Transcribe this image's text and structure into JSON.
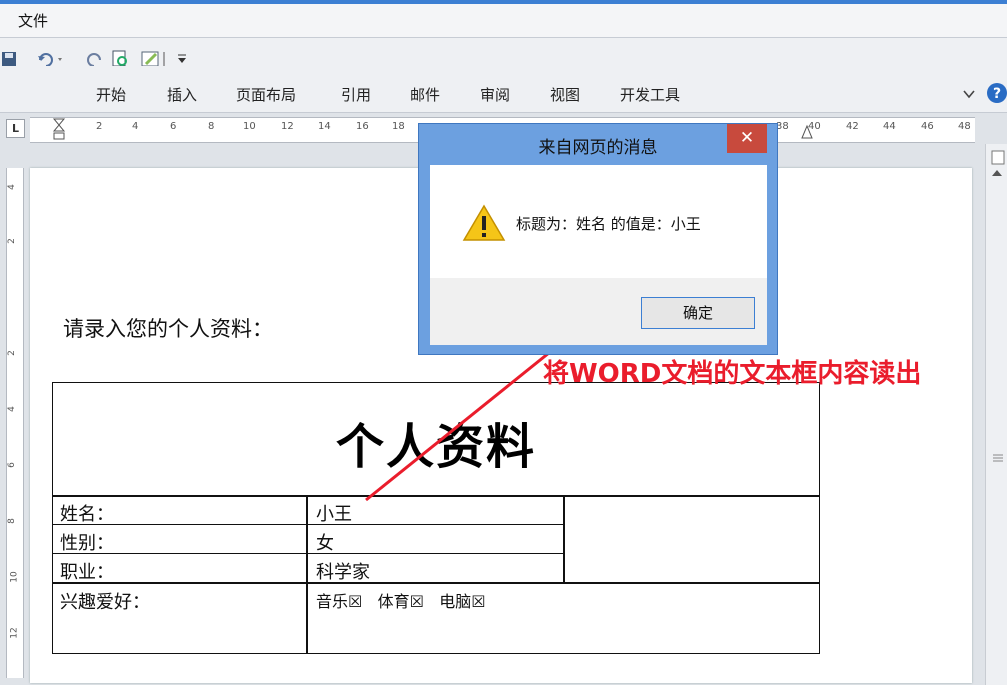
{
  "menubar": {
    "file_label": "文件"
  },
  "ribbon": {
    "tabs": [
      "开始",
      "插入",
      "页面布局",
      "引用",
      "邮件",
      "审阅",
      "视图",
      "开发工具"
    ]
  },
  "ruler": {
    "corner": "L",
    "h_numbers": [
      "2",
      "4",
      "6",
      "8",
      "10",
      "12",
      "14",
      "16",
      "18",
      "38",
      "40",
      "42",
      "44",
      "46",
      "48"
    ],
    "v_numbers": [
      "4",
      "2",
      "",
      "2",
      "4",
      "6",
      "8",
      "10",
      "12"
    ]
  },
  "document": {
    "prompt": "请录入您的个人资料：",
    "heading": "个人资料",
    "rows": [
      {
        "label": "姓名：",
        "value": "小王"
      },
      {
        "label": "性别：",
        "value": "女"
      },
      {
        "label": "职业：",
        "value": "科学家"
      },
      {
        "label": "兴趣爱好：",
        "value": "音乐☒   体育☒   电脑☒"
      }
    ]
  },
  "dialog": {
    "title": "来自网页的消息",
    "close": "✕",
    "message": "标题为：姓名 的值是：小王",
    "ok_label": "确定"
  },
  "annotation": {
    "text": "将WORD文档的文本框内容读出",
    "color": "#ea1d2c"
  },
  "colors": {
    "accent": "#3c7fd3",
    "close_button": "#c84a3d"
  }
}
